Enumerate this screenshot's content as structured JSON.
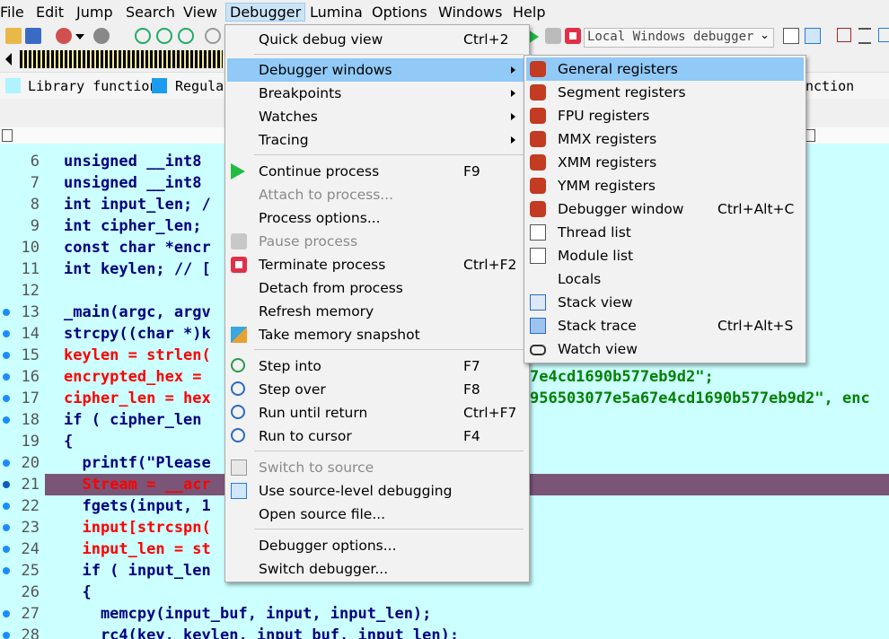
{
  "menubar": [
    "File",
    "Edit",
    "Jump",
    "Search",
    "View",
    "Debugger",
    "Lumina",
    "Options",
    "Windows",
    "Help"
  ],
  "toolbar": {
    "debugger_select": "Local Windows debugger"
  },
  "legend": {
    "item1": "Library function",
    "item2": "Regular",
    "item3": "nction"
  },
  "code": {
    "lines": [
      {
        "n": "6",
        "t": "unsigned __int8"
      },
      {
        "n": "7",
        "t": "unsigned __int8"
      },
      {
        "n": "8",
        "t": "int input_len; /"
      },
      {
        "n": "9",
        "t": "int cipher_len;"
      },
      {
        "n": "10",
        "t": "const char *encr"
      },
      {
        "n": "11",
        "t": "int keylen; // ["
      },
      {
        "n": "12",
        "t": ""
      },
      {
        "n": "13",
        "t": "_main(argc, argv"
      },
      {
        "n": "14",
        "t": "strcpy((char *)k"
      },
      {
        "n": "15",
        "t": "keylen = strlen("
      },
      {
        "n": "16",
        "t": "encrypted_hex = ",
        "t2": "7e4cd1690b577eb9d2\";"
      },
      {
        "n": "17",
        "t": "cipher_len = hex",
        "t2": "956503077e5a67e4cd1690b577eb9d2\", enc"
      },
      {
        "n": "18",
        "t": "if ( cipher_len"
      },
      {
        "n": "19",
        "t": "{"
      },
      {
        "n": "20",
        "t": "  printf(\"Please"
      },
      {
        "n": "21",
        "t": "  Stream = __acr"
      },
      {
        "n": "22",
        "t": "  fgets(input, 1"
      },
      {
        "n": "23",
        "t": "  input[strcspn("
      },
      {
        "n": "24",
        "t": "  input_len = st"
      },
      {
        "n": "25",
        "t": "  if ( input_len"
      },
      {
        "n": "26",
        "t": "  {"
      },
      {
        "n": "27",
        "t": "    memcpy(input_buf, input, input_len);"
      },
      {
        "n": "28",
        "t": "    rc4(key, keylen, input_buf, input_len);"
      }
    ]
  },
  "debugger_menu": {
    "quick_debug_view": "Quick debug view",
    "quick_debug_view_sc": "Ctrl+2",
    "debugger_windows": "Debugger windows",
    "breakpoints": "Breakpoints",
    "watches": "Watches",
    "tracing": "Tracing",
    "continue_process": "Continue process",
    "continue_process_sc": "F9",
    "attach_to_process": "Attach to process...",
    "process_options": "Process options...",
    "pause_process": "Pause process",
    "terminate_process": "Terminate process",
    "terminate_process_sc": "Ctrl+F2",
    "detach_from_process": "Detach from process",
    "refresh_memory": "Refresh memory",
    "take_memory_snapshot": "Take memory snapshot",
    "step_into": "Step into",
    "step_into_sc": "F7",
    "step_over": "Step over",
    "step_over_sc": "F8",
    "run_until_return": "Run until return",
    "run_until_return_sc": "Ctrl+F7",
    "run_to_cursor": "Run to cursor",
    "run_to_cursor_sc": "F4",
    "switch_to_source": "Switch to source",
    "use_source_level": "Use source-level debugging",
    "open_source_file": "Open source file...",
    "debugger_options": "Debugger options...",
    "switch_debugger": "Switch debugger..."
  },
  "windows_submenu": {
    "general_registers": "General registers",
    "segment_registers": "Segment registers",
    "fpu_registers": "FPU registers",
    "mmx_registers": "MMX registers",
    "xmm_registers": "XMM registers",
    "ymm_registers": "YMM registers",
    "debugger_window": "Debugger window",
    "debugger_window_sc": "Ctrl+Alt+C",
    "thread_list": "Thread list",
    "module_list": "Module list",
    "locals": "Locals",
    "stack_view": "Stack view",
    "stack_trace": "Stack trace",
    "stack_trace_sc": "Ctrl+Alt+S",
    "watch_view": "Watch view"
  },
  "colors": {
    "code_bg": "#ccffff",
    "highlight_row": "#7a5577",
    "menu_selected": "#91c9f7"
  }
}
